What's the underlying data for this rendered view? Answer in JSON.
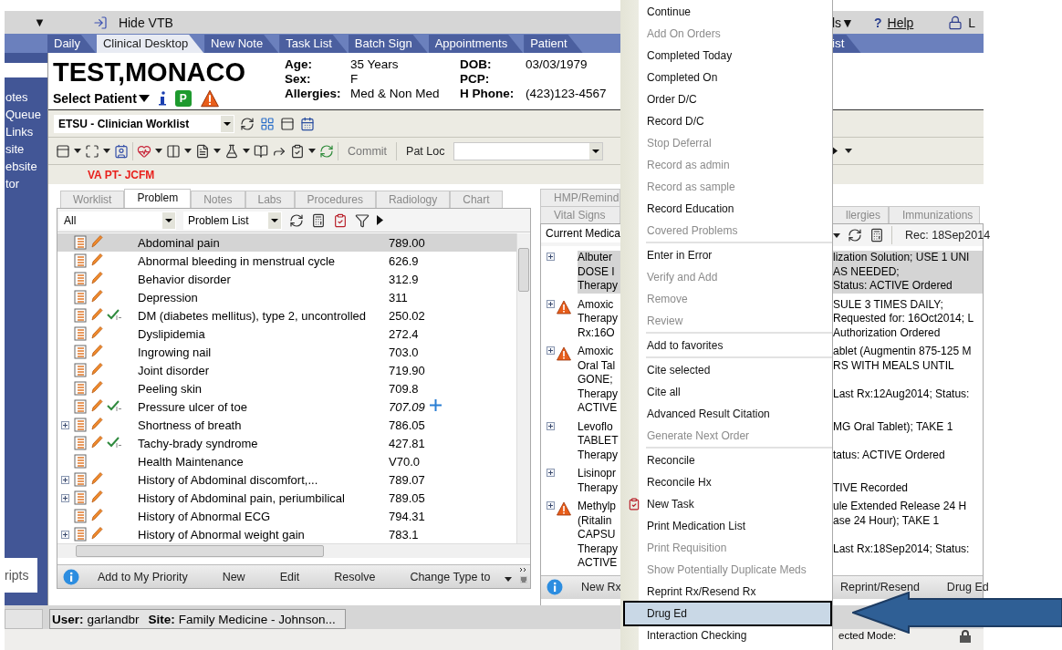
{
  "menubar": {
    "caret": "▼",
    "hide_vtb": "Hide VTB",
    "tools": "ls▼",
    "help_mark": "?",
    "help": "Help",
    "lock_label": "L"
  },
  "tabs": [
    {
      "label": "Daily",
      "selected": false
    },
    {
      "label": "Clinical Desktop",
      "selected": true
    },
    {
      "label": "New Note",
      "selected": false
    },
    {
      "label": "Task List",
      "selected": false
    },
    {
      "label": "Batch Sign",
      "selected": false
    },
    {
      "label": "Appointments",
      "selected": false
    },
    {
      "label": "Patient",
      "selected": false
    }
  ],
  "tab_fragment": "ist",
  "sidebar": {
    "items": [
      "otes",
      "Queue",
      "Links",
      "site",
      "ebsite",
      "tor"
    ],
    "footer": "ripts"
  },
  "patient": {
    "name": "TEST,MONACO",
    "select_patient": "Select Patient",
    "p_badge": "P",
    "fields_left": [
      {
        "label": "Age:",
        "value": "35 Years"
      },
      {
        "label": "Sex:",
        "value": "F"
      },
      {
        "label": "Allergies:",
        "value": "Med & Non Med"
      }
    ],
    "fields_right": [
      {
        "label": "DOB:",
        "value": "03/03/1979"
      },
      {
        "label": "PCP:"
      },
      {
        "label": "H Phone:",
        "value": "(423)123-4567"
      }
    ]
  },
  "toolbar1": {
    "worklist": "ETSU - Clinician Worklist"
  },
  "toolbar2": {
    "commit": "Commit",
    "pat_loc": "Pat Loc"
  },
  "location_banner": "VA PT- JCFM",
  "left_panel": {
    "tabs": [
      {
        "label": "Worklist",
        "selected": false
      },
      {
        "label": "Problem",
        "selected": true
      },
      {
        "label": "Notes",
        "selected": false
      },
      {
        "label": "Labs",
        "selected": false
      },
      {
        "label": "Procedures",
        "selected": false
      },
      {
        "label": "Radiology",
        "selected": false
      },
      {
        "label": "Chart",
        "selected": false
      }
    ],
    "scope": "All",
    "list": "Problem List",
    "problems": [
      {
        "name": "Abdominal pain",
        "code": "789.00",
        "selected": true,
        "expandable": false,
        "editable": true,
        "hc": false,
        "added": false,
        "italic": false
      },
      {
        "name": "Abnormal bleeding in menstrual cycle",
        "code": "626.9",
        "selected": false,
        "expandable": false,
        "editable": true,
        "hc": false,
        "added": false,
        "italic": false
      },
      {
        "name": "Behavior disorder",
        "code": "312.9",
        "selected": false,
        "expandable": false,
        "editable": true,
        "hc": false,
        "added": false,
        "italic": false
      },
      {
        "name": "Depression",
        "code": "311",
        "selected": false,
        "expandable": false,
        "editable": true,
        "hc": false,
        "added": false,
        "italic": false
      },
      {
        "name": "DM (diabetes mellitus), type 2, uncontrolled",
        "code": "250.02",
        "selected": false,
        "expandable": false,
        "editable": true,
        "hc": true,
        "added": false,
        "italic": false
      },
      {
        "name": "Dyslipidemia",
        "code": "272.4",
        "selected": false,
        "expandable": false,
        "editable": true,
        "hc": false,
        "added": false,
        "italic": false
      },
      {
        "name": "Ingrowing nail",
        "code": "703.0",
        "selected": false,
        "expandable": false,
        "editable": true,
        "hc": false,
        "added": false,
        "italic": false
      },
      {
        "name": "Joint disorder",
        "code": "719.90",
        "selected": false,
        "expandable": false,
        "editable": true,
        "hc": false,
        "added": false,
        "italic": false
      },
      {
        "name": "Peeling skin",
        "code": "709.8",
        "selected": false,
        "expandable": false,
        "editable": true,
        "hc": false,
        "added": false,
        "italic": false
      },
      {
        "name": "Pressure ulcer of toe",
        "code": "707.09",
        "selected": false,
        "expandable": false,
        "editable": true,
        "hc": true,
        "added": true,
        "italic": true
      },
      {
        "name": "Shortness of breath",
        "code": "786.05",
        "selected": false,
        "expandable": true,
        "editable": true,
        "hc": false,
        "added": false,
        "italic": false
      },
      {
        "name": "Tachy-brady syndrome",
        "code": "427.81",
        "selected": false,
        "expandable": false,
        "editable": true,
        "hc": true,
        "added": false,
        "italic": false
      },
      {
        "name": "Health Maintenance",
        "code": "V70.0",
        "selected": false,
        "expandable": false,
        "editable": false,
        "hc": false,
        "added": false,
        "italic": false
      },
      {
        "name": "History of Abdominal discomfort,...",
        "code": "789.07",
        "selected": false,
        "expandable": true,
        "editable": true,
        "hc": false,
        "added": false,
        "italic": false
      },
      {
        "name": "History of Abdominal pain, periumbilical",
        "code": "789.05",
        "selected": false,
        "expandable": true,
        "editable": true,
        "hc": false,
        "added": false,
        "italic": false
      },
      {
        "name": "History of Abnormal ECG",
        "code": "794.31",
        "selected": false,
        "expandable": false,
        "editable": true,
        "hc": false,
        "added": false,
        "italic": false
      },
      {
        "name": "History of Abnormal weight gain",
        "code": "783.1",
        "selected": false,
        "expandable": true,
        "editable": true,
        "hc": false,
        "added": false,
        "italic": false
      }
    ],
    "actions": [
      "Add to My Priority",
      "New",
      "Edit",
      "Resolve",
      "Change Type to"
    ]
  },
  "right_panel": {
    "tabs_top": [
      {
        "label": "HMP/Remind",
        "selected": false
      }
    ],
    "tabs": [
      {
        "label": "Vital Signs",
        "selected": false
      },
      {
        "label": "llergies",
        "selected": false
      },
      {
        "label": "Immunizations",
        "selected": false
      }
    ],
    "view": "Current Medica",
    "rec": "Rec: 18Sep2014",
    "medications": [
      {
        "selected": true,
        "warning": false,
        "lines": [
          {
            "left": "Albuter",
            "right": "lization Solution; USE 1 UNI"
          },
          {
            "left": "DOSE I",
            "right": "AS NEEDED;"
          },
          {
            "left": "Therapy",
            "right": "Status: ACTIVE Ordered"
          }
        ]
      },
      {
        "selected": false,
        "warning": true,
        "lines": [
          {
            "left": "Amoxic",
            "right": "SULE 3 TIMES DAILY;"
          },
          {
            "left": "Therapy",
            "right": "Requested for: 16Oct2014; L"
          },
          {
            "left": "Rx:16O",
            "right": "Authorization Ordered"
          }
        ]
      },
      {
        "selected": false,
        "warning": true,
        "lines": [
          {
            "left": "Amoxic",
            "right": "ablet (Augmentin 875-125 M"
          },
          {
            "left": "Oral Tal",
            "right": "RS WITH MEALS UNTIL"
          },
          {
            "left": "GONE;"
          },
          {
            "left": "Therapy",
            "right": "Last Rx:12Aug2014; Status:"
          },
          {
            "left": "ACTIVE"
          }
        ]
      },
      {
        "selected": false,
        "warning": false,
        "lines": [
          {
            "left": "Levoflo",
            "right": "MG Oral Tablet); TAKE 1"
          },
          {
            "left": "TABLET"
          },
          {
            "left": "Therapy",
            "right": "tatus: ACTIVE Ordered"
          }
        ]
      },
      {
        "selected": false,
        "warning": false,
        "lines": [
          {
            "left": "Lisinopr"
          },
          {
            "left": "Therapy",
            "right": "TIVE Recorded"
          }
        ]
      },
      {
        "selected": false,
        "warning": true,
        "lines": [
          {
            "left": "Methylp",
            "right": "ule Extended Release 24 H"
          },
          {
            "left": "(Ritalin",
            "right": "ase 24 Hour); TAKE 1"
          },
          {
            "left": "CAPSU"
          },
          {
            "left": "Therapy",
            "right": "Last Rx:18Sep2014; Status:"
          },
          {
            "left": "ACTIVE"
          }
        ]
      }
    ],
    "actions_left": [
      "New Rx"
    ],
    "actions_right": [
      "Reprint/Resend",
      "Drug Ed"
    ]
  },
  "status_bar": {
    "user_label": "User:",
    "user": "garlandbr",
    "site_label": "Site:",
    "site": "Family Medicine - Johnson..."
  },
  "mode_text": "ected Mode:",
  "context_menu": {
    "items": [
      {
        "kind": "item",
        "label": "Continue",
        "disabled": false,
        "selected": false
      },
      {
        "kind": "item",
        "label": "Add On Orders",
        "disabled": true,
        "selected": false
      },
      {
        "kind": "item",
        "label": "Completed Today",
        "disabled": false,
        "selected": false
      },
      {
        "kind": "item",
        "label": "Completed On",
        "disabled": false,
        "selected": false
      },
      {
        "kind": "item",
        "label": "Order D/C",
        "disabled": false,
        "selected": false
      },
      {
        "kind": "item",
        "label": "Record D/C",
        "disabled": false,
        "selected": false
      },
      {
        "kind": "item",
        "label": "Stop Deferral",
        "disabled": true,
        "selected": false
      },
      {
        "kind": "item",
        "label": "Record as admin",
        "disabled": true,
        "selected": false
      },
      {
        "kind": "item",
        "label": "Record as sample",
        "disabled": true,
        "selected": false
      },
      {
        "kind": "item",
        "label": "Record Education",
        "disabled": false,
        "selected": false
      },
      {
        "kind": "item",
        "label": "Covered Problems",
        "disabled": true,
        "selected": false
      },
      {
        "kind": "separator"
      },
      {
        "kind": "item",
        "label": "Enter in Error",
        "disabled": false,
        "selected": false
      },
      {
        "kind": "item",
        "label": "Verify and Add",
        "disabled": true,
        "selected": false
      },
      {
        "kind": "item",
        "label": "Remove",
        "disabled": true,
        "selected": false
      },
      {
        "kind": "item",
        "label": "Review",
        "disabled": true,
        "selected": false
      },
      {
        "kind": "separator"
      },
      {
        "kind": "item",
        "label": "Add to favorites",
        "disabled": false,
        "selected": false
      },
      {
        "kind": "separator"
      },
      {
        "kind": "item",
        "label": "Cite selected",
        "disabled": false,
        "selected": false
      },
      {
        "kind": "item",
        "label": "Cite all",
        "disabled": false,
        "selected": false
      },
      {
        "kind": "item",
        "label": "Advanced Result Citation",
        "disabled": false,
        "selected": false
      },
      {
        "kind": "item",
        "label": "Generate Next Order",
        "disabled": true,
        "selected": false
      },
      {
        "kind": "separator"
      },
      {
        "kind": "item",
        "label": "Reconcile",
        "disabled": false,
        "selected": false
      },
      {
        "kind": "item",
        "label": "Reconcile Hx",
        "disabled": false,
        "selected": false
      },
      {
        "kind": "icon_item",
        "label": "New Task",
        "disabled": false,
        "selected": false
      },
      {
        "kind": "item",
        "label": "Print Medication List",
        "disabled": false,
        "selected": false
      },
      {
        "kind": "item",
        "label": "Print Requisition",
        "disabled": true,
        "selected": false
      },
      {
        "kind": "item",
        "label": "Show Potentially Duplicate Meds",
        "disabled": true,
        "selected": false
      },
      {
        "kind": "item",
        "label": "Reprint Rx/Resend Rx",
        "disabled": false,
        "selected": false
      },
      {
        "kind": "item",
        "label": "Drug Ed",
        "disabled": false,
        "selected": true
      },
      {
        "kind": "item",
        "label": "Interaction Checking",
        "disabled": false,
        "selected": false
      }
    ]
  }
}
